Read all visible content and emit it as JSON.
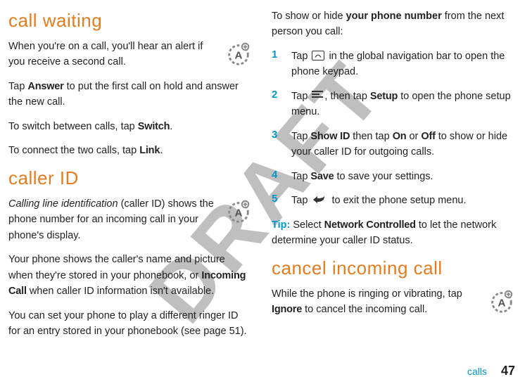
{
  "watermark": "DRAFT",
  "left_column": {
    "section1_title": "call waiting",
    "section1_p1": "When you're on a call, you'll hear an alert if you receive a second call.",
    "section1_p2_a": "Tap ",
    "section1_p2_answer": "Answer",
    "section1_p2_b": " to put the first call on hold and answer the new call.",
    "section1_p3_a": "To switch between calls, tap ",
    "section1_p3_switch": "Switch",
    "section1_p3_b": ".",
    "section1_p4_a": "To connect the two calls, tap ",
    "section1_p4_link": "Link",
    "section1_p4_b": ".",
    "section2_title": "caller ID",
    "section2_p1_a": "Calling line identification",
    "section2_p1_b": " (caller ID) shows the phone number for an incoming call in your phone's display.",
    "section2_p2_a": "Your phone shows the caller's name and picture when they're stored in your phonebook, or ",
    "section2_p2_incoming": "Incoming Call",
    "section2_p2_b": " when caller ID information isn't available.",
    "section2_p3": "You can set your phone to play a different ringer ID for an entry stored in your phonebook (see page 51)."
  },
  "right_column": {
    "intro_a": "To show or hide ",
    "intro_bold": "your phone number",
    "intro_b": " from the next person you call:",
    "step1_num": "1",
    "step1_text": "Tap         in the global navigation bar to open the phone keypad.",
    "step1_a": "Tap ",
    "step1_b": " in the global navigation bar to open the phone keypad.",
    "step2_num": "2",
    "step2_a": "Tap ",
    "step2_b": ", then tap ",
    "step2_setup": "Setup",
    "step2_c": " to open the phone setup menu.",
    "step3_num": "3",
    "step3_a": "Tap ",
    "step3_showid": "Show ID",
    "step3_b": " then tap ",
    "step3_on": "On",
    "step3_c": " or ",
    "step3_off": "Off",
    "step3_d": " to show or hide your caller ID for outgoing calls.",
    "step4_num": "4",
    "step4_a": "Tap ",
    "step4_save": "Save",
    "step4_b": " to save your settings.",
    "step5_num": "5",
    "step5_a": "Tap ",
    "step5_b": " to exit the phone setup menu.",
    "tip_label": "Tip:",
    "tip_a": " Select ",
    "tip_network": "Network Controlled",
    "tip_b": " to let the network determine your caller ID status.",
    "section3_title": "cancel incoming call",
    "section3_p1_a": "While the phone is ringing or vibrating, tap ",
    "section3_p1_ignore": "Ignore",
    "section3_p1_b": " to cancel the incoming call."
  },
  "footer": {
    "section": "calls",
    "page": "47"
  }
}
